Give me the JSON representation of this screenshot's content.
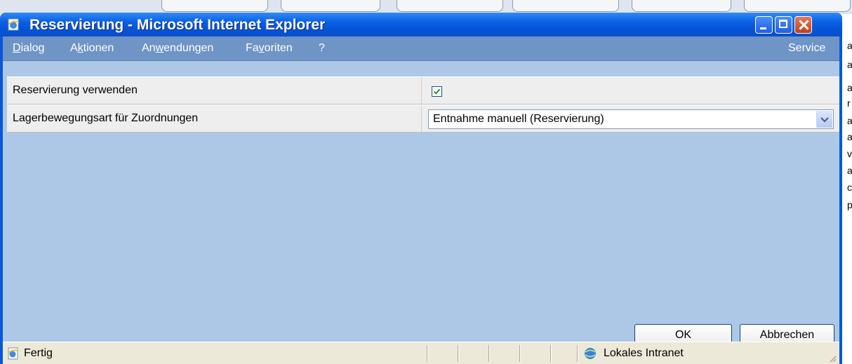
{
  "window": {
    "title": "Reservierung - Microsoft Internet Explorer",
    "controls": [
      "minimize",
      "maximize",
      "close"
    ]
  },
  "menu": {
    "items": [
      {
        "label": "Dialog"
      },
      {
        "label": "Aktionen"
      },
      {
        "label": "Anwendungen"
      },
      {
        "label": "Favoriten"
      },
      {
        "label": "?"
      }
    ],
    "service": "Service"
  },
  "form": {
    "rows": [
      {
        "label": "Reservierung verwenden",
        "checked": true
      },
      {
        "label": "Lagerbewegungsart für Zuordnungen",
        "value": "Entnahme manuell (Reservierung)"
      }
    ]
  },
  "buttons": {
    "ok": "OK",
    "cancel": "Abbrechen"
  },
  "status": {
    "text": "Fertig",
    "zone": "Lokales Intranet"
  },
  "background_fragments": [
    "a",
    "a",
    "a",
    "r",
    "a",
    "a",
    "v",
    "a",
    "c",
    "p"
  ],
  "colors": {
    "titlebar": "#0a5fe4",
    "menubar": "#6f94c6",
    "content": "#adc8e6",
    "statusbar": "#ece9d8"
  }
}
